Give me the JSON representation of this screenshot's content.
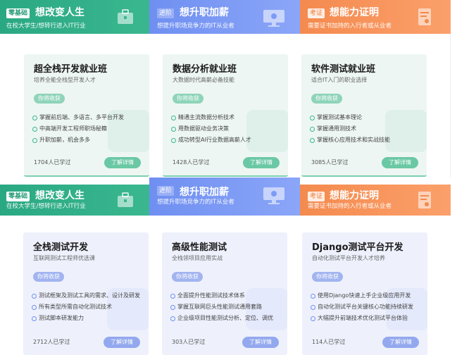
{
  "sections": [
    {
      "headers": [
        {
          "tag": "零基础",
          "title": "想改变人生",
          "subtitle": "在校大学生/想转行进入IT行业"
        },
        {
          "tag": "进阶",
          "title": "想升职加薪",
          "subtitle": "想提升职场竞争力的IT从业者"
        },
        {
          "tag": "考证",
          "title": "想能力证明",
          "subtitle": "需要证书加持的入行者或从业者"
        }
      ],
      "cards": [
        {
          "title": "超全栈开发就业班",
          "desc": "培养全能全栈型开发人才",
          "gain": "你将收获",
          "points": [
            "掌握前后端、多语言、多平台开发",
            "中高端开发工程师职场秘籍",
            "升职加薪，机会多多"
          ],
          "learners": "1704人已学过",
          "more": "了解详情"
        },
        {
          "title": "数据分析就业班",
          "desc": "大数据时代高薪必备技能",
          "gain": "你将收获",
          "points": [
            "精通主流数据分析技术",
            "用数据驱动业务决策",
            "成功转型AI行业数据高薪人才"
          ],
          "learners": "1428人已学过",
          "more": "了解详情"
        },
        {
          "title": "软件测试就业班",
          "desc": "适合IT入门的职业选择",
          "gain": "你将收获",
          "points": [
            "掌握测试基本理论",
            "掌握通用测技术",
            "掌握核心应用技术和实战技能"
          ],
          "learners": "3085人已学过",
          "more": "了解详情"
        }
      ]
    },
    {
      "headers": [
        {
          "tag": "零基础",
          "title": "想改变人生",
          "subtitle": "在校大学生/想转行进入IT行业"
        },
        {
          "tag": "进阶",
          "title": "想升职加薪",
          "subtitle": "想提升职场竞争力的IT从业者"
        },
        {
          "tag": "考证",
          "title": "想能力证明",
          "subtitle": "需要证书加持的入行者或从业者"
        }
      ],
      "cards": [
        {
          "title": "全栈测试开发",
          "desc": "互联网测试工程师优选课",
          "gain": "你将收获",
          "points": [
            "测试框架及测试工具的需求、设计及研发",
            "所有类型所需自动化测试技术",
            "测试脚本研发能力"
          ],
          "learners": "2712人已学过",
          "more": "了解详情"
        },
        {
          "title": "高级性能测试",
          "desc": "全栈领项目应用实战",
          "gain": "你将收获",
          "points": [
            "全面提升性能测试技术体系",
            "掌握互联网巨头性能测试通用套路",
            "企业级项目性能测试分析、定位、调优"
          ],
          "learners": "303人已学过",
          "more": "了解详情"
        },
        {
          "title": "Django测试平台开发",
          "desc": "自动化测试平台开发人才培养",
          "gain": "你将收获",
          "points": [
            "使用Django快速上手企业级应用开发",
            "自动化测试平台关键核心功能持续研发",
            "大幅提升前端技术优化测试平台体验"
          ],
          "learners": "114人已学过",
          "more": "了解详情"
        }
      ]
    }
  ]
}
